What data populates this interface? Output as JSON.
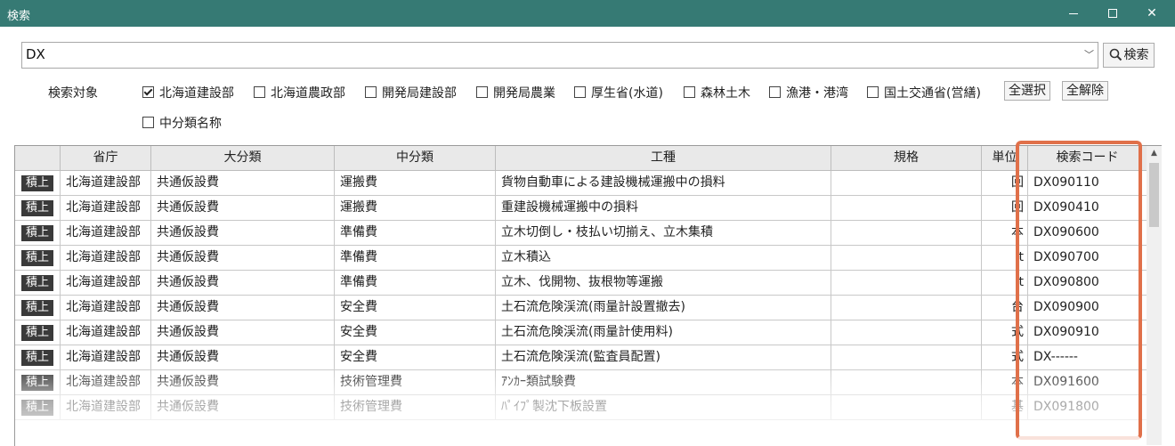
{
  "window": {
    "title": "検索"
  },
  "search": {
    "value": "DX",
    "button_label": "検索"
  },
  "filters": {
    "label": "検索対象",
    "options": [
      {
        "label": "北海道建設部",
        "checked": true
      },
      {
        "label": "北海道農政部",
        "checked": false
      },
      {
        "label": "開発局建設部",
        "checked": false
      },
      {
        "label": "開発局農業",
        "checked": false
      },
      {
        "label": "厚生省(水道)",
        "checked": false
      },
      {
        "label": "森林土木",
        "checked": false
      },
      {
        "label": "漁港・港湾",
        "checked": false
      },
      {
        "label": "国土交通省(営繕)",
        "checked": false
      },
      {
        "label": "中分類名称",
        "checked": false
      }
    ],
    "select_all_label": "全選択",
    "clear_all_label": "全解除"
  },
  "table": {
    "columns": [
      "",
      "省庁",
      "大分類",
      "中分類",
      "工種",
      "規格",
      "単位",
      "検索コード"
    ],
    "rows": [
      {
        "badge": "積上",
        "ministry": "北海道建設部",
        "major": "共通仮設費",
        "middle": "運搬費",
        "work": "貨物自動車による建設機械運搬中の損料",
        "spec": "",
        "unit": "回",
        "code": "DX090110"
      },
      {
        "badge": "積上",
        "ministry": "北海道建設部",
        "major": "共通仮設費",
        "middle": "運搬費",
        "work": "重建設機械運搬中の損料",
        "spec": "",
        "unit": "回",
        "code": "DX090410"
      },
      {
        "badge": "積上",
        "ministry": "北海道建設部",
        "major": "共通仮設費",
        "middle": "準備費",
        "work": "立木切倒し・枝払い切揃え、立木集積",
        "spec": "",
        "unit": "本",
        "code": "DX090600"
      },
      {
        "badge": "積上",
        "ministry": "北海道建設部",
        "major": "共通仮設費",
        "middle": "準備費",
        "work": "立木積込",
        "spec": "",
        "unit": "t",
        "code": "DX090700"
      },
      {
        "badge": "積上",
        "ministry": "北海道建設部",
        "major": "共通仮設費",
        "middle": "準備費",
        "work": "立木、伐開物、抜根物等運搬",
        "spec": "",
        "unit": "t",
        "code": "DX090800"
      },
      {
        "badge": "積上",
        "ministry": "北海道建設部",
        "major": "共通仮設費",
        "middle": "安全費",
        "work": "土石流危険渓流(雨量計設置撤去)",
        "spec": "",
        "unit": "台",
        "code": "DX090900"
      },
      {
        "badge": "積上",
        "ministry": "北海道建設部",
        "major": "共通仮設費",
        "middle": "安全費",
        "work": "土石流危険渓流(雨量計使用料)",
        "spec": "",
        "unit": "式",
        "code": "DX090910"
      },
      {
        "badge": "積上",
        "ministry": "北海道建設部",
        "major": "共通仮設費",
        "middle": "安全費",
        "work": "土石流危険渓流(監査員配置)",
        "spec": "",
        "unit": "式",
        "code": "DX------"
      },
      {
        "badge": "積上",
        "ministry": "北海道建設部",
        "major": "共通仮設費",
        "middle": "技術管理費",
        "work": "ｱﾝｶｰ類試験費",
        "spec": "",
        "unit": "本",
        "code": "DX091600"
      },
      {
        "badge": "積上",
        "ministry": "北海道建設部",
        "major": "共通仮設費",
        "middle": "技術管理費",
        "work": "ﾊﾟｲﾌﾟ製沈下板設置",
        "spec": "",
        "unit": "基",
        "code": "DX091800"
      }
    ]
  },
  "colors": {
    "titlebar": "#367a74",
    "highlight": "#e0704a",
    "badge": "#3a3a3a"
  },
  "icons": {
    "search": "magnifier-icon",
    "dropdown": "chevron-down-icon"
  }
}
